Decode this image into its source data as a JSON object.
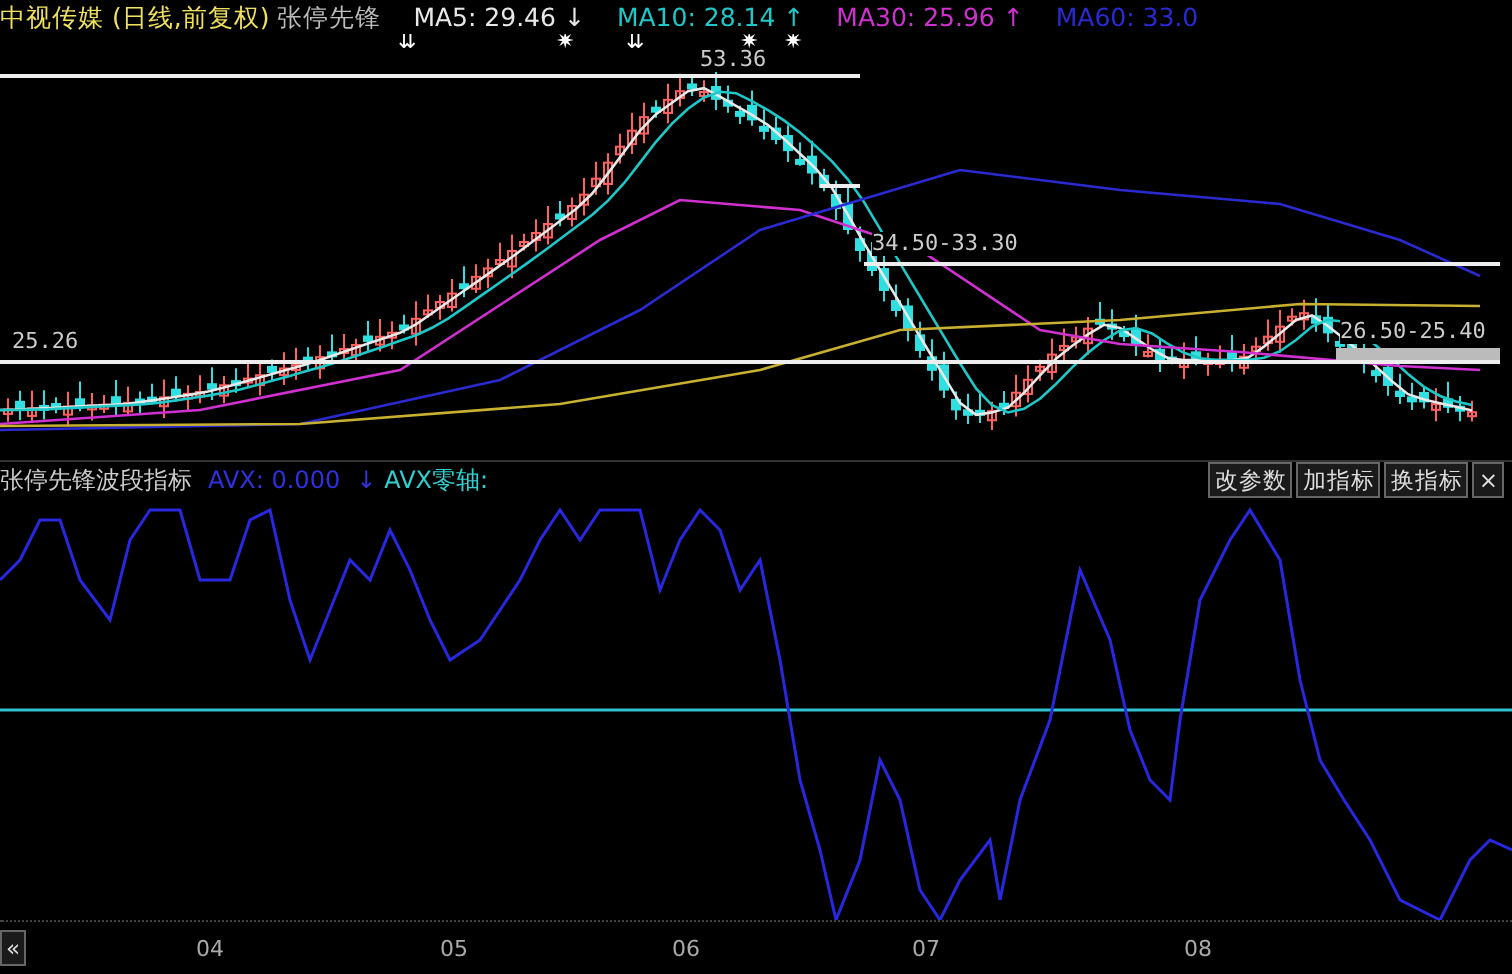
{
  "header": {
    "stock": "中视传媒",
    "period": "(日线,前复权)",
    "indicator": "张停先锋",
    "ma": [
      {
        "label": "MA5: 29.46",
        "arrow": "↓",
        "color": "#e8e8e8"
      },
      {
        "label": "MA10: 28.14",
        "arrow": "↑",
        "color": "#1fc8c8"
      },
      {
        "label": "MA30: 25.96",
        "arrow": "↑",
        "color": "#d030d0"
      },
      {
        "label": "MA60: 33.0",
        "color": "#2a2ad0"
      }
    ]
  },
  "signals": [
    "⇊",
    "✷",
    "⇊",
    "✷",
    "✷"
  ],
  "price_labels": [
    "53.36",
    "25.26",
    "34.50-33.30",
    "26.50-25.40"
  ],
  "indicator_panel": {
    "title": "张停先锋波段指标",
    "avx": "AVX: 0.000",
    "arrow": "↓",
    "zero_label": "AVX零轴:",
    "buttons": [
      "改参数",
      "加指标",
      "换指标"
    ],
    "close": "×"
  },
  "axis": {
    "scroll": "«",
    "months": [
      "04",
      "05",
      "06",
      "07",
      "08"
    ]
  }
}
